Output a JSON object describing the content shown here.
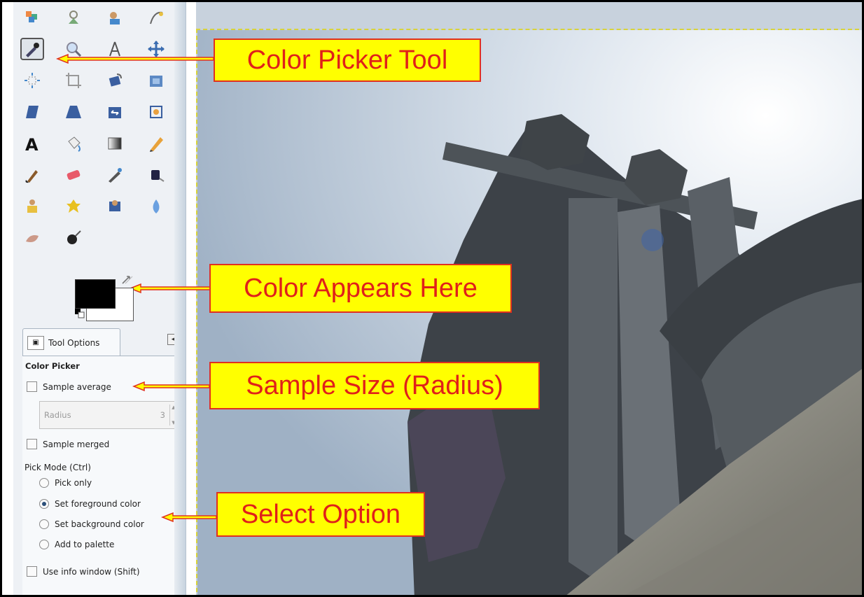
{
  "toolbox": {
    "tools": [
      {
        "name": "free-select-icon-row0-a",
        "glyph": "select"
      },
      {
        "name": "fuzzy-select-icon",
        "glyph": "fuzzy"
      },
      {
        "name": "foreground-select-icon",
        "glyph": "fgselect"
      },
      {
        "name": "paths-icon",
        "glyph": "paths"
      },
      {
        "name": "color-picker-tool-icon",
        "glyph": "picker"
      },
      {
        "name": "zoom-tool-icon",
        "glyph": "zoom"
      },
      {
        "name": "measure-tool-icon",
        "glyph": "measure"
      },
      {
        "name": "move-tool-icon",
        "glyph": "move"
      },
      {
        "name": "align-tool-icon",
        "glyph": "align"
      },
      {
        "name": "crop-tool-icon",
        "glyph": "crop"
      },
      {
        "name": "rotate-tool-icon",
        "glyph": "rotate"
      },
      {
        "name": "scale-tool-icon",
        "glyph": "scale"
      },
      {
        "name": "shear-tool-icon",
        "glyph": "shear"
      },
      {
        "name": "perspective-tool-icon",
        "glyph": "perspective"
      },
      {
        "name": "flip-tool-icon",
        "glyph": "flip"
      },
      {
        "name": "cage-transform-icon",
        "glyph": "cage"
      },
      {
        "name": "text-tool-icon",
        "glyph": "text"
      },
      {
        "name": "bucket-fill-icon",
        "glyph": "bucket"
      },
      {
        "name": "blend-tool-icon",
        "glyph": "blend"
      },
      {
        "name": "pencil-tool-icon",
        "glyph": "pencil"
      },
      {
        "name": "paintbrush-tool-icon",
        "glyph": "brush"
      },
      {
        "name": "eraser-tool-icon",
        "glyph": "eraser"
      },
      {
        "name": "airbrush-tool-icon",
        "glyph": "airbrush"
      },
      {
        "name": "ink-tool-icon",
        "glyph": "ink"
      },
      {
        "name": "clone-tool-icon",
        "glyph": "clone"
      },
      {
        "name": "heal-tool-icon",
        "glyph": "heal"
      },
      {
        "name": "perspective-clone-icon",
        "glyph": "pclone"
      },
      {
        "name": "blur-sharpen-icon",
        "glyph": "blur"
      },
      {
        "name": "smudge-tool-icon",
        "glyph": "smudge"
      },
      {
        "name": "dodge-burn-icon",
        "glyph": "dodge"
      }
    ],
    "fg_color": "#000000",
    "bg_color": "#ffffff"
  },
  "tool_options": {
    "tab_label": "Tool Options",
    "title": "Color Picker",
    "sample_average": "Sample average",
    "radius_label": "Radius",
    "radius_value": "3",
    "sample_merged": "Sample merged",
    "pick_mode_label": "Pick Mode  (Ctrl)",
    "pick_only": "Pick only",
    "set_foreground": "Set foreground color",
    "set_background": "Set background color",
    "add_to_palette": "Add to palette",
    "use_info_window": "Use info window  (Shift)"
  },
  "callouts": {
    "color_picker_tool": "Color Picker Tool",
    "color_appears_here": "Color Appears Here",
    "sample_size": "Sample Size (Radius)",
    "select_option": "Select Option"
  },
  "colors": {
    "callout_bg": "#ffff00",
    "callout_text": "#e0201a",
    "callout_border": "#e03020"
  }
}
